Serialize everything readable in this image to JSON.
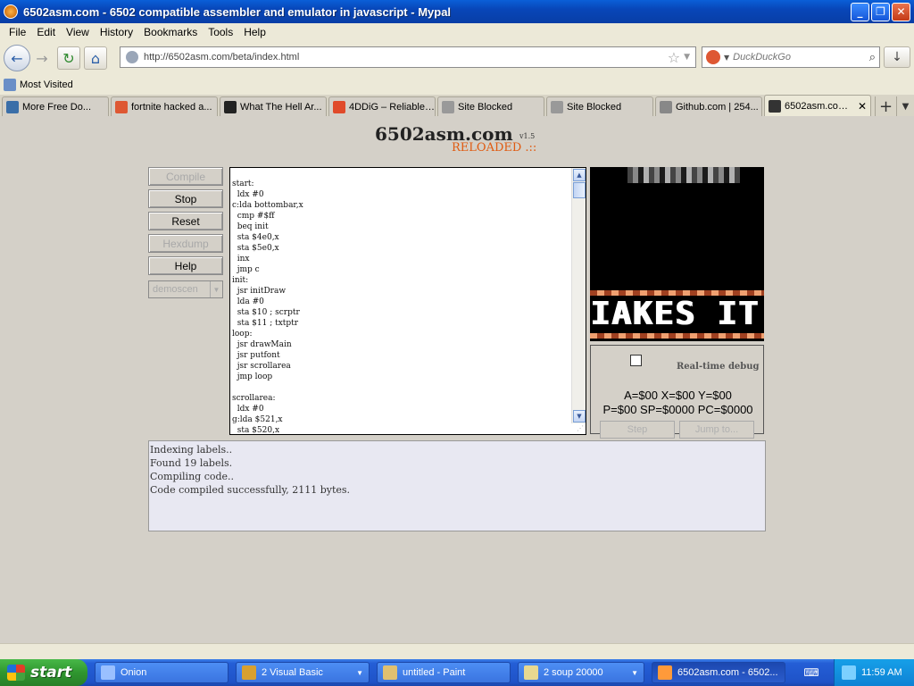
{
  "window": {
    "title": "6502asm.com - 6502 compatible assembler and emulator in javascript - Mypal",
    "minimize_glyph": "_",
    "maximize_glyph": "❐",
    "close_glyph": "✕"
  },
  "menu": [
    "File",
    "Edit",
    "View",
    "History",
    "Bookmarks",
    "Tools",
    "Help"
  ],
  "nav": {
    "back_glyph": "←",
    "forward_glyph": "→",
    "reload_glyph": "↻",
    "home_glyph": "⌂",
    "url": "http://6502asm.com/beta/index.html",
    "search_placeholder": "DuckDuckGo",
    "download_glyph": "↓"
  },
  "bookmarks": {
    "most_visited": "Most Visited"
  },
  "tabs": [
    {
      "label": "More Free Do...",
      "color": "#3a6ea8"
    },
    {
      "label": "fortnite hacked a...",
      "color": "#de5833"
    },
    {
      "label": "What The Hell Ar...",
      "color": "#222222"
    },
    {
      "label": "4DDiG – Reliable ...",
      "color": "#e04a2a"
    },
    {
      "label": "Site Blocked",
      "color": "#999999"
    },
    {
      "label": "Site Blocked",
      "color": "#999999"
    },
    {
      "label": "Github.com | 254...",
      "color": "#888888"
    },
    {
      "label": "6502asm.com...",
      "color": "#333333",
      "active": true
    }
  ],
  "page": {
    "logo": "6502asm.com",
    "version": "v1.5",
    "reloaded": "RELOADED .::",
    "buttons": {
      "compile": "Compile",
      "stop": "Stop",
      "reset": "Reset",
      "hexdump": "Hexdump",
      "help": "Help"
    },
    "demo_select": "demoscen",
    "code": "start:\n  ldx #0\nc:lda bottombar,x\n  cmp #$ff\n  beq init\n  sta $4e0,x\n  sta $5e0,x\n  inx\n  jmp c\ninit:\n  jsr initDraw\n  lda #0\n  sta $10 ; scrptr\n  sta $11 ; txtptr\nloop:\n  jsr drawMain\n  jsr putfont\n  jsr scrollarea\n  jmp loop\n\nscrollarea:\n  ldx #0\ng:lda $521,x\n  sta $520,x",
    "screen_text": "IAKES IT",
    "debug": {
      "label": "Real-time debug",
      "regs_line1": "A=$00 X=$00 Y=$00",
      "regs_line2": "P=$00 SP=$0000 PC=$0000",
      "step": "Step",
      "jump": "Jump to..."
    },
    "console": [
      "Indexing labels..",
      "Found 19 labels.",
      "Compiling code..",
      "Code compiled successfully, 2111 bytes."
    ]
  },
  "taskbar": {
    "start": "start",
    "tasks": [
      {
        "label": "Onion",
        "color": "#9ac0ff",
        "dropdown": false
      },
      {
        "label": "2 Visual Basic",
        "color": "#d8a030",
        "dropdown": true
      },
      {
        "label": "untitled - Paint",
        "color": "#e0c070",
        "dropdown": false
      },
      {
        "label": "2 soup 20000",
        "color": "#e8d890",
        "dropdown": true
      },
      {
        "label": "6502asm.com - 6502...",
        "color": "#ff9a3a",
        "dropdown": false,
        "active": true
      }
    ],
    "keyboard_glyph": "⌨",
    "clock": "11:59 AM"
  }
}
